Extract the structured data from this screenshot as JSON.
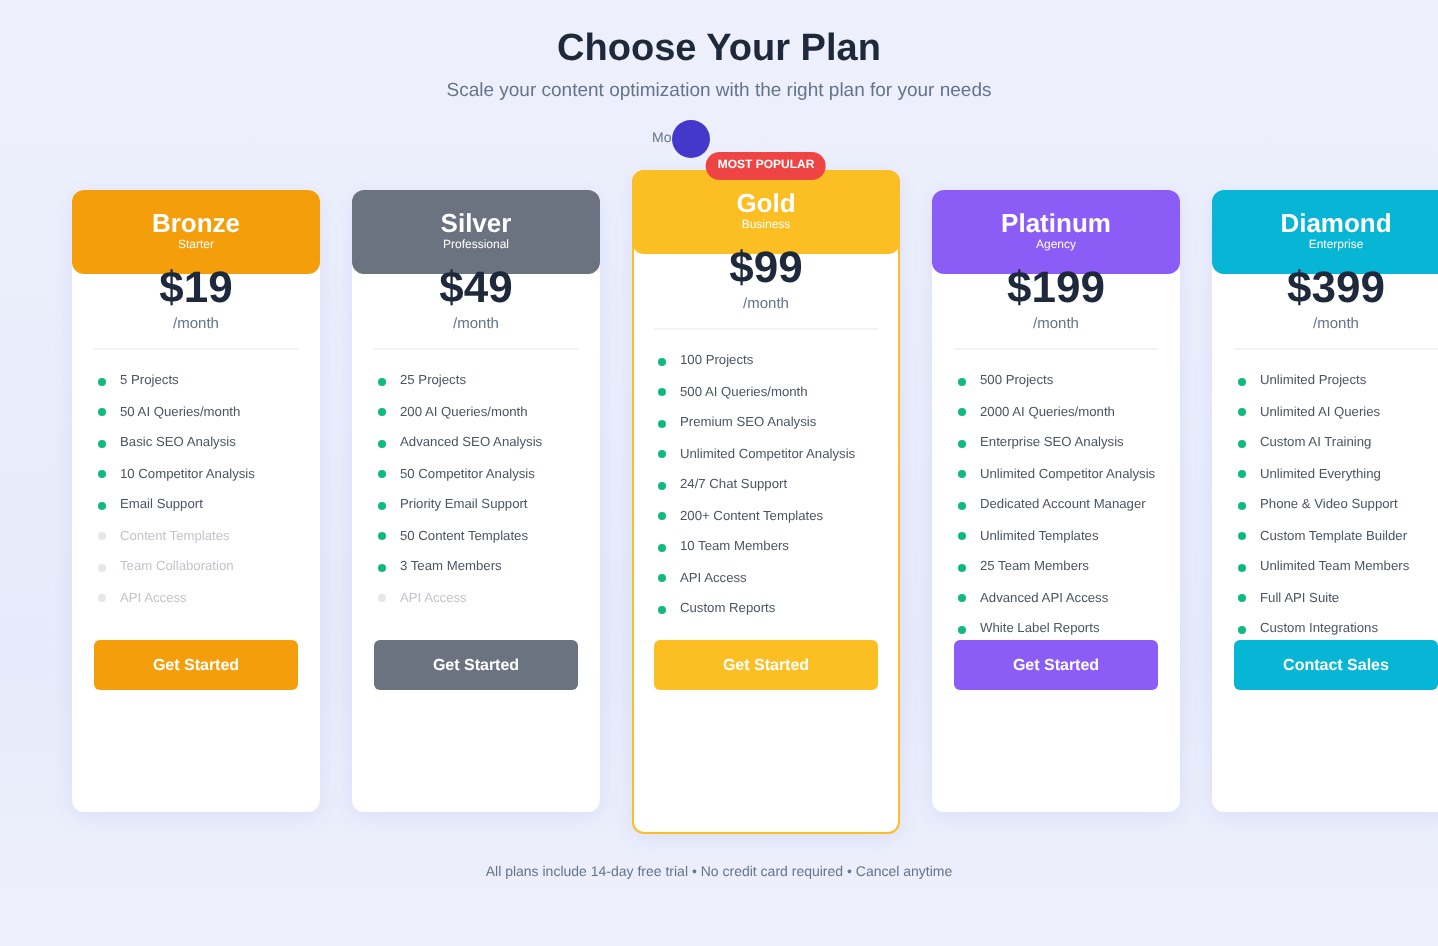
{
  "title": "Choose Your Plan",
  "subtitle": "Scale your content optimization with the right plan for your needs",
  "billing_toggle": {
    "label": "Mo",
    "on": false
  },
  "plans": [
    {
      "name": "Bronze",
      "tier": "Starter",
      "price": "$19",
      "period": "/month",
      "color": "#f59e0b",
      "featured": false,
      "button": "Get Started",
      "features": [
        {
          "text": "5 Projects",
          "included": true
        },
        {
          "text": "50 AI Queries/month",
          "included": true
        },
        {
          "text": "Basic SEO Analysis",
          "included": true
        },
        {
          "text": "10 Competitor Analysis",
          "included": true
        },
        {
          "text": "Email Support",
          "included": true
        },
        {
          "text": "Content Templates",
          "included": false
        },
        {
          "text": "Team Collaboration",
          "included": false
        },
        {
          "text": "API Access",
          "included": false
        }
      ]
    },
    {
      "name": "Silver",
      "tier": "Professional",
      "price": "$49",
      "period": "/month",
      "color": "#6b7280",
      "featured": false,
      "button": "Get Started",
      "features": [
        {
          "text": "25 Projects",
          "included": true
        },
        {
          "text": "200 AI Queries/month",
          "included": true
        },
        {
          "text": "Advanced SEO Analysis",
          "included": true
        },
        {
          "text": "50 Competitor Analysis",
          "included": true
        },
        {
          "text": "Priority Email Support",
          "included": true
        },
        {
          "text": "50 Content Templates",
          "included": true
        },
        {
          "text": "3 Team Members",
          "included": true
        },
        {
          "text": "API Access",
          "included": false
        }
      ]
    },
    {
      "name": "Gold",
      "tier": "Business",
      "price": "$99",
      "period": "/month",
      "color": "#fbbf24",
      "featured": true,
      "badge": "MOST POPULAR",
      "button": "Get Started",
      "features": [
        {
          "text": "100 Projects",
          "included": true
        },
        {
          "text": "500 AI Queries/month",
          "included": true
        },
        {
          "text": "Premium SEO Analysis",
          "included": true
        },
        {
          "text": "Unlimited Competitor Analysis",
          "included": true
        },
        {
          "text": "24/7 Chat Support",
          "included": true
        },
        {
          "text": "200+ Content Templates",
          "included": true
        },
        {
          "text": "10 Team Members",
          "included": true
        },
        {
          "text": "API Access",
          "included": true
        },
        {
          "text": "Custom Reports",
          "included": true
        }
      ]
    },
    {
      "name": "Platinum",
      "tier": "Agency",
      "price": "$199",
      "period": "/month",
      "color": "#8b5cf6",
      "featured": false,
      "button": "Get Started",
      "features": [
        {
          "text": "500 Projects",
          "included": true
        },
        {
          "text": "2000 AI Queries/month",
          "included": true
        },
        {
          "text": "Enterprise SEO Analysis",
          "included": true
        },
        {
          "text": "Unlimited Competitor Analysis",
          "included": true
        },
        {
          "text": "Dedicated Account Manager",
          "included": true
        },
        {
          "text": "Unlimited Templates",
          "included": true
        },
        {
          "text": "25 Team Members",
          "included": true
        },
        {
          "text": "Advanced API Access",
          "included": true
        },
        {
          "text": "White Label Reports",
          "included": true
        }
      ]
    },
    {
      "name": "Diamond",
      "tier": "Enterprise",
      "price": "$399",
      "period": "/month",
      "color": "#06b6d4",
      "featured": false,
      "button": "Contact Sales",
      "features": [
        {
          "text": "Unlimited Projects",
          "included": true
        },
        {
          "text": "Unlimited AI Queries",
          "included": true
        },
        {
          "text": "Custom AI Training",
          "included": true
        },
        {
          "text": "Unlimited Everything",
          "included": true
        },
        {
          "text": "Phone & Video Support",
          "included": true
        },
        {
          "text": "Custom Template Builder",
          "included": true
        },
        {
          "text": "Unlimited Team Members",
          "included": true
        },
        {
          "text": "Full API Suite",
          "included": true
        },
        {
          "text": "Custom Integrations",
          "included": true
        }
      ]
    }
  ],
  "footer": "All plans include 14-day free trial • No credit card required • Cancel anytime"
}
